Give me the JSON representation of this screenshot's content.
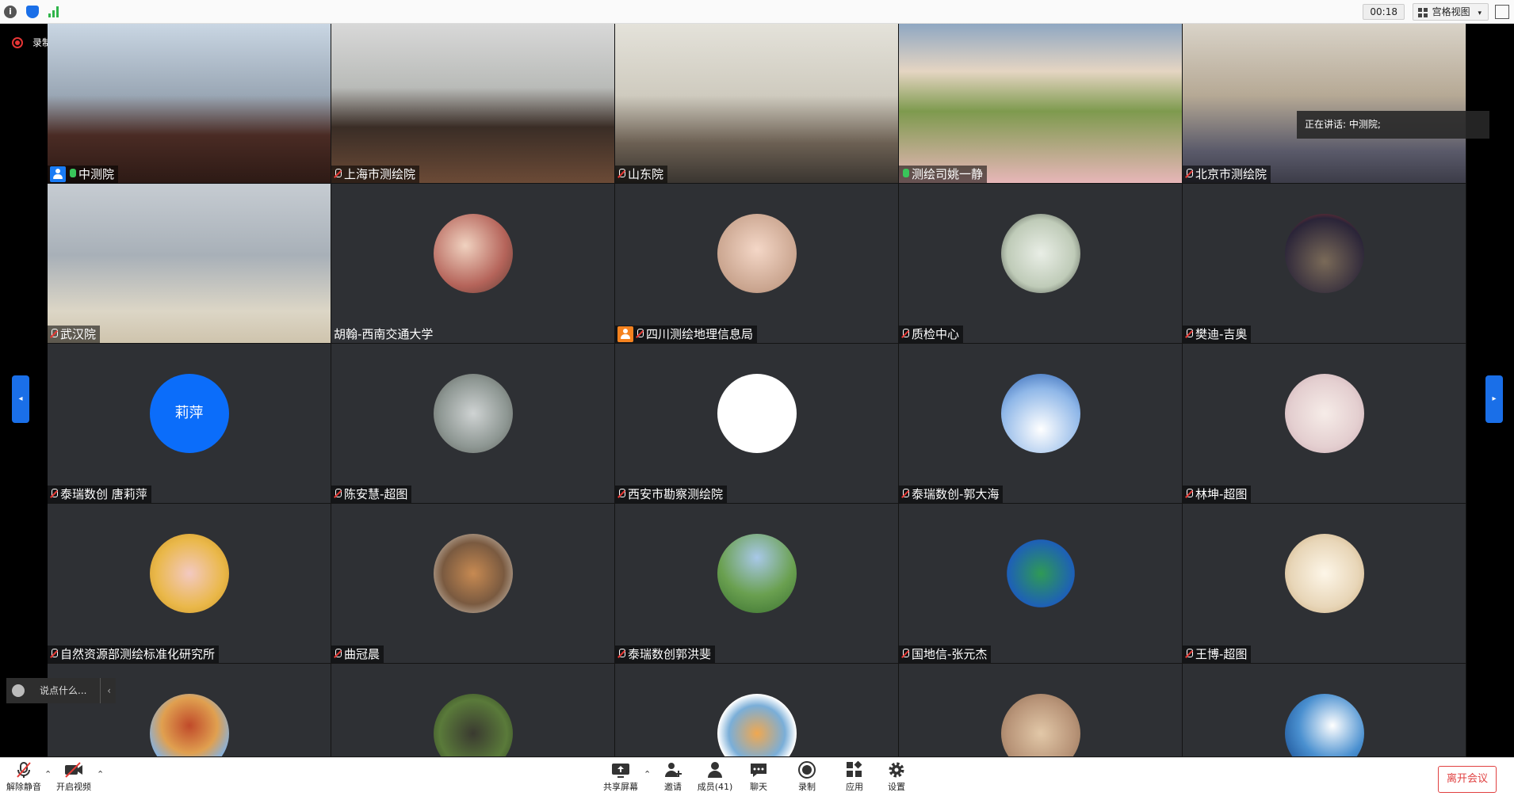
{
  "topbar": {
    "timer": "00:18",
    "view_mode": "宫格视图"
  },
  "recording_label": "录制中",
  "speaking_label": "正在讲话: 中测院;",
  "participants": [
    {
      "name": "中测院",
      "kind": "video",
      "badge": "host-blue",
      "mic": "on",
      "scene": "office-meeting"
    },
    {
      "name": "上海市测绘院",
      "kind": "video",
      "mic": "muted",
      "scene": "conference-room"
    },
    {
      "name": "山东院",
      "kind": "video",
      "mic": "muted",
      "scene": "conference-table"
    },
    {
      "name": "测绘司姚一静",
      "kind": "video",
      "mic": "on",
      "scene": "landscape-background-woman"
    },
    {
      "name": "北京市测绘院",
      "kind": "video",
      "mic": "muted",
      "scene": "bookshelf"
    },
    {
      "name": "武汉院",
      "kind": "video",
      "mic": "muted",
      "scene": "man-at-desk"
    },
    {
      "name": "胡翰-西南交通大学",
      "kind": "avatar",
      "mic": "none",
      "avatar": "family-photo"
    },
    {
      "name": "四川测绘地理信息局",
      "kind": "avatar",
      "badge": "host-orange",
      "mic": "muted",
      "avatar": "baby-face"
    },
    {
      "name": "质检中心",
      "kind": "avatar",
      "mic": "muted",
      "avatar": "succulent"
    },
    {
      "name": "樊迪-吉奥",
      "kind": "avatar",
      "mic": "muted",
      "avatar": "child-night-street"
    },
    {
      "name": "泰瑞数创 唐莉萍",
      "kind": "avatar",
      "mic": "muted",
      "avatar_text": "莉萍"
    },
    {
      "name": "陈安慧-超图",
      "kind": "avatar",
      "mic": "muted",
      "avatar": "child-swing-sea"
    },
    {
      "name": "西安市勘察测绘院",
      "kind": "avatar",
      "mic": "muted",
      "avatar": "blue-logo"
    },
    {
      "name": "泰瑞数创-郭大海",
      "kind": "avatar",
      "mic": "muted",
      "avatar": "penguins"
    },
    {
      "name": "林坤-超图",
      "kind": "avatar",
      "mic": "muted",
      "avatar": "anime-doll"
    },
    {
      "name": "自然资源部测绘标准化研究所",
      "kind": "avatar",
      "mic": "muted",
      "avatar": "pig-toys"
    },
    {
      "name": "曲冠晨",
      "kind": "avatar",
      "mic": "muted",
      "avatar": "dog-window"
    },
    {
      "name": "泰瑞数创郭洪斐",
      "kind": "avatar",
      "mic": "muted",
      "avatar": "park-trees"
    },
    {
      "name": "国地信-张元杰",
      "kind": "avatar",
      "mic": "muted",
      "avatar": "globe-logo"
    },
    {
      "name": "王博-超图",
      "kind": "avatar",
      "mic": "muted",
      "avatar": "boy-portrait"
    },
    {
      "name": "",
      "kind": "avatar",
      "mic": "none",
      "avatar": "pagoda"
    },
    {
      "name": "",
      "kind": "avatar",
      "mic": "none",
      "avatar": "gorilla"
    },
    {
      "name": "",
      "kind": "avatar",
      "mic": "none",
      "avatar": "cartoon-bear"
    },
    {
      "name": "",
      "kind": "avatar",
      "mic": "none",
      "avatar": "woman-illustration"
    },
    {
      "name": "",
      "kind": "avatar",
      "mic": "none",
      "avatar": "wave-bird"
    }
  ],
  "chat": {
    "placeholder": "说点什么..."
  },
  "toolbar": {
    "unmute": "解除静音",
    "start_video": "开启视频",
    "share_screen": "共享屏幕",
    "invite": "邀请",
    "members": "成员(41)",
    "chat": "聊天",
    "record": "录制",
    "apps": "应用",
    "settings": "设置",
    "leave": "离开会议"
  }
}
